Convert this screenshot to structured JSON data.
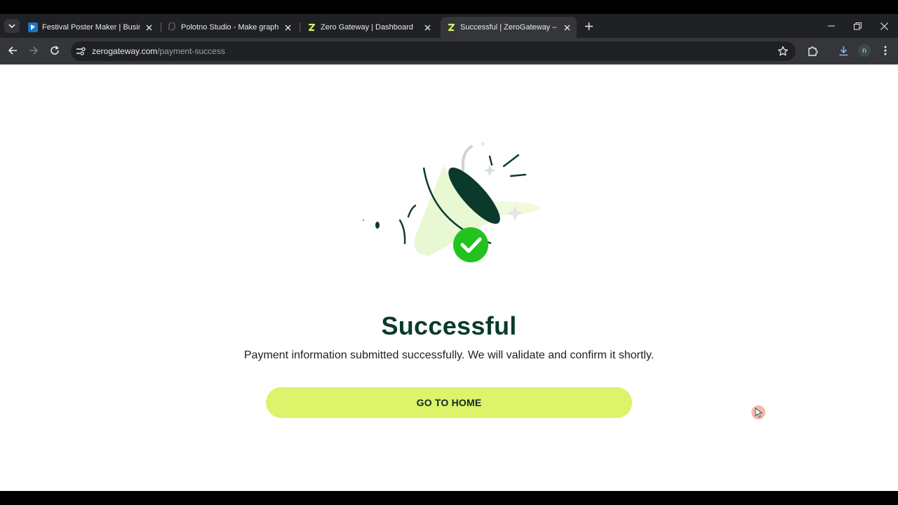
{
  "browser": {
    "tabs": [
      {
        "title": "Festival Poster Maker | Business",
        "favicon": "blue-flag-icon",
        "active": false
      },
      {
        "title": "Polotno Studio - Make graphics",
        "favicon": "polotno-icon",
        "active": false
      },
      {
        "title": "Zero Gateway | Dashboard",
        "favicon": "zerogateway-z-icon",
        "active": false
      },
      {
        "title": "Successful | ZeroGateway – No",
        "favicon": "zerogateway-z-icon",
        "active": true
      }
    ],
    "url_host": "zerogateway.com",
    "url_path": "/payment-success",
    "profile_initial": "n"
  },
  "page": {
    "heading": "Successful",
    "message": "Payment information submitted successfully. We will validate and confirm it shortly.",
    "home_button": "GO TO HOME"
  },
  "colors": {
    "accent": "#dcf36a",
    "heading": "#0b3a2c",
    "success_green": "#22c21f",
    "tab_bg": "#35363a"
  }
}
